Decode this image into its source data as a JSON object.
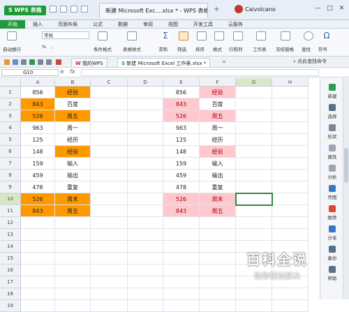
{
  "app": {
    "logo": "S WPS 表格",
    "doc_tab": "新建 Microsoft Exc....xlsx * - WPS 表格",
    "add_tab": "+",
    "user": "Caivolcano"
  },
  "window_controls": [
    "—",
    "□",
    "✕"
  ],
  "menu": [
    "开始",
    "插入",
    "页面布局",
    "公式",
    "数据",
    "审阅",
    "视图",
    "开发工具",
    "云服务"
  ],
  "ribbon": {
    "wrap": "自动换行",
    "format_box": "常规",
    "percent_group": "% ,",
    "items": [
      "条件格式",
      "表格样式",
      "求和",
      "筛选",
      "排序",
      "格式",
      "行和列",
      "工作表",
      "冻结窗格",
      "查找",
      "符号"
    ]
  },
  "sheet_tabs": [
    "我的WPS",
    "新建 Microsoft Excel 工作表.xlsx *"
  ],
  "tab_search": "点此查找命令",
  "formula_bar": {
    "name_box": "G10",
    "fx": "fx",
    "value": ""
  },
  "columns": [
    "A",
    "B",
    "C",
    "D",
    "E",
    "F",
    "G",
    "H"
  ],
  "rows": [
    "1",
    "2",
    "3",
    "4",
    "5",
    "6",
    "7",
    "8",
    "9",
    "10",
    "11",
    "12",
    "13",
    "14",
    "15",
    "16",
    "17",
    "18",
    "19"
  ],
  "data": {
    "A": [
      "856",
      "843",
      "526",
      "963",
      "125",
      "148",
      "159",
      "459",
      "478",
      "526",
      "843"
    ],
    "B": [
      "经验",
      "百度",
      "周五",
      "周一",
      "经历",
      "经验",
      "输入",
      "输出",
      "重复",
      "周末",
      "周五"
    ],
    "E": [
      "856",
      "843",
      "526",
      "963",
      "125",
      "148",
      "159",
      "459",
      "478",
      "526",
      "843"
    ],
    "F": [
      "经验",
      "百度",
      "周五",
      "周一",
      "经历",
      "经验",
      "输入",
      "输出",
      "重复",
      "周末",
      "周五"
    ]
  },
  "highlight": {
    "orange": "#ff9900",
    "pink": "#ffc7ce",
    "pink_text": "#9c0006"
  },
  "sidebar": [
    "新建",
    "选择",
    "形状",
    "属性",
    "分析",
    "传图",
    "推荐",
    "分享",
    "备份",
    "帮助"
  ],
  "watermark": {
    "title": "百科全说",
    "subtitle": "助你轻松解决"
  }
}
